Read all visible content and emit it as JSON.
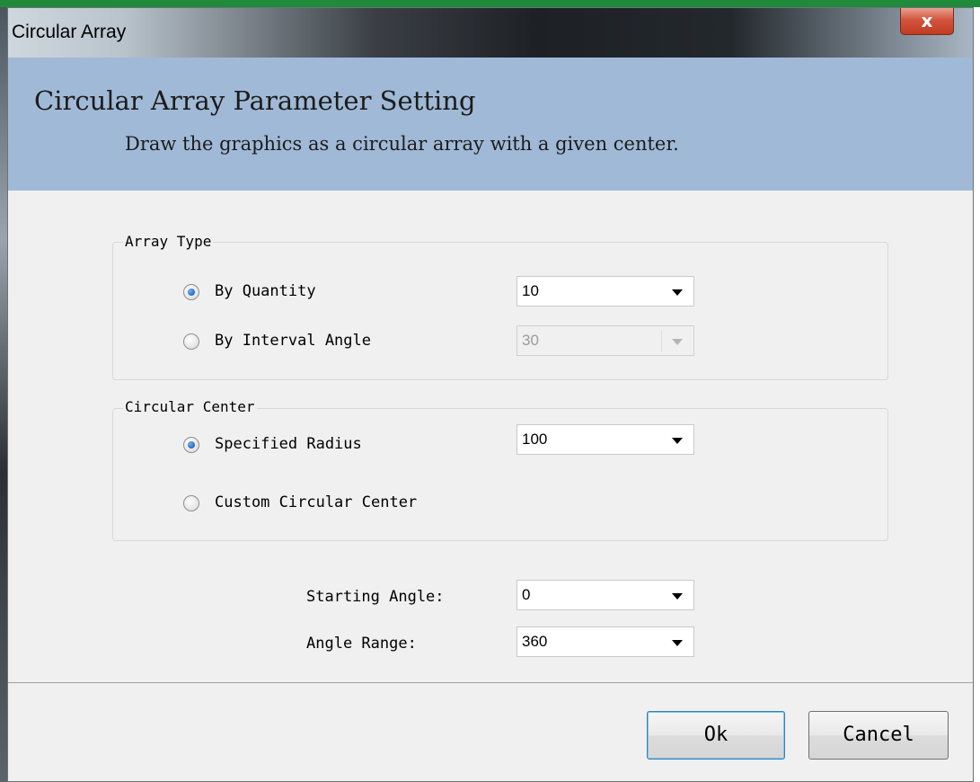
{
  "window": {
    "title": "Circular Array",
    "close_glyph": "x"
  },
  "banner": {
    "title": "Circular Array Parameter Setting",
    "subtitle": "Draw the graphics as a circular array with a given center."
  },
  "array_type": {
    "label": "Array Type",
    "by_quantity": {
      "label": "By Quantity",
      "checked": true,
      "value": "10"
    },
    "by_interval_angle": {
      "label": "By Interval Angle",
      "checked": false,
      "value": "30",
      "disabled": true
    }
  },
  "circular_center": {
    "label": "Circular Center",
    "specified_radius": {
      "label": "Specified Radius",
      "checked": true,
      "value": "100"
    },
    "custom_center": {
      "label": "Custom Circular Center",
      "checked": false
    }
  },
  "starting_angle": {
    "label": "Starting Angle:",
    "value": "0"
  },
  "angle_range": {
    "label": "Angle Range:",
    "value": "360"
  },
  "buttons": {
    "ok": "Ok",
    "cancel": "Cancel"
  },
  "icons": {
    "close": "close-icon",
    "radio": "radio-icon",
    "dropdown": "chevron-down-icon"
  }
}
